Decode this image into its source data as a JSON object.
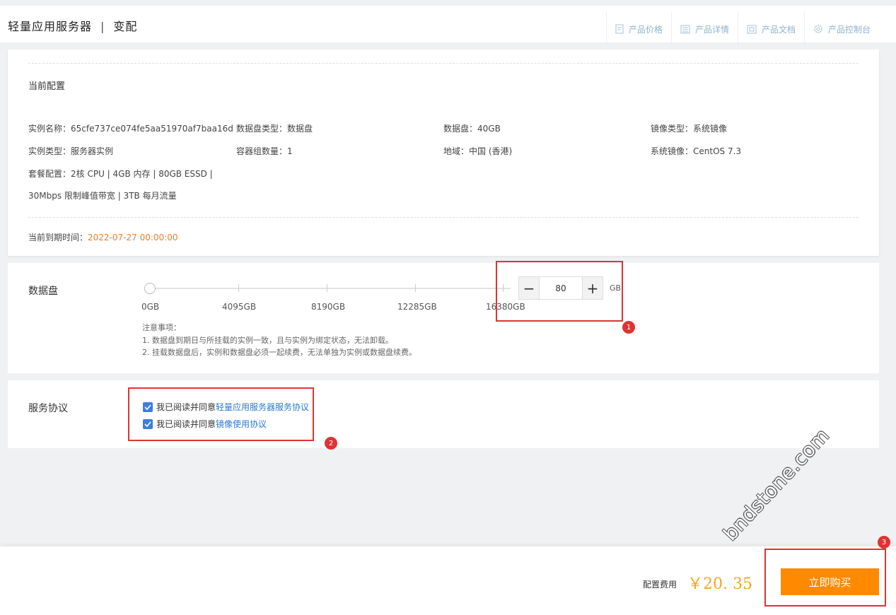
{
  "header": {
    "title": "轻量应用服务器",
    "separator": "|",
    "subtitle": "变配",
    "links": [
      {
        "label": "产品价格",
        "icon": "doc-icon"
      },
      {
        "label": "产品详情",
        "icon": "list-icon"
      },
      {
        "label": "产品文档",
        "icon": "book-icon"
      },
      {
        "label": "产品控制台",
        "icon": "gear-icon"
      }
    ]
  },
  "current_config": {
    "title": "当前配置",
    "fields": [
      {
        "label": "实例名称：",
        "value": "65cfe737ce074fe5aa51970af7baa16d"
      },
      {
        "label": "数据盘类型：",
        "value": "数据盘"
      },
      {
        "label": "数据盘：",
        "value": "40GB"
      },
      {
        "label": "镜像类型：",
        "value": "系统镜像"
      },
      {
        "label": "实例类型：",
        "value": "服务器实例"
      },
      {
        "label": "容器组数量：",
        "value": "1"
      },
      {
        "label": "地域：",
        "value": "中国 (香港)"
      },
      {
        "label": "系统镜像：",
        "value": "CentOS 7.3"
      },
      {
        "label": "套餐配置：",
        "value": "2核 CPU | 4GB 内存 | 80GB ESSD |"
      }
    ],
    "package_line2": "30Mbps 限制峰值带宽 | 3TB 每月流量",
    "expire_label": "当前到期时间：",
    "expire_value": "2022-07-27 00:00:00"
  },
  "data_disk": {
    "label": "数据盘",
    "slider_labels": [
      "0GB",
      "4095GB",
      "8190GB",
      "12285GB",
      "16380GB"
    ],
    "value": "80",
    "minus": "−",
    "plus": "+",
    "unit": "GB",
    "notes": [
      "注意事项：",
      "1. 数据盘到期日与所挂载的实例一致，且与实例为绑定状态，无法卸载。",
      "2. 挂载数据盘后，实例和数据盘必须一起续费，无法单独为实例或数据盘续费。"
    ]
  },
  "agreement": {
    "label": "服务协议",
    "items": [
      {
        "prefix": "我已阅读并同意",
        "link": "轻量应用服务器服务协议",
        "checked": true
      },
      {
        "prefix": "我已阅读并同意",
        "link": "镜像使用协议",
        "checked": true
      }
    ]
  },
  "annotations": {
    "badge1": "1",
    "badge2": "2",
    "badge3": "3"
  },
  "watermark": "bndstone.com",
  "footer": {
    "fee_label": "配置费用",
    "fee_value": "￥20. 35",
    "buy_label": "立即购买"
  },
  "colors": {
    "accent": "#ff8a00",
    "price": "#f5a623",
    "link": "#2a7bd2",
    "checkbox": "#3d7fe0",
    "annotation": "#e03333"
  }
}
